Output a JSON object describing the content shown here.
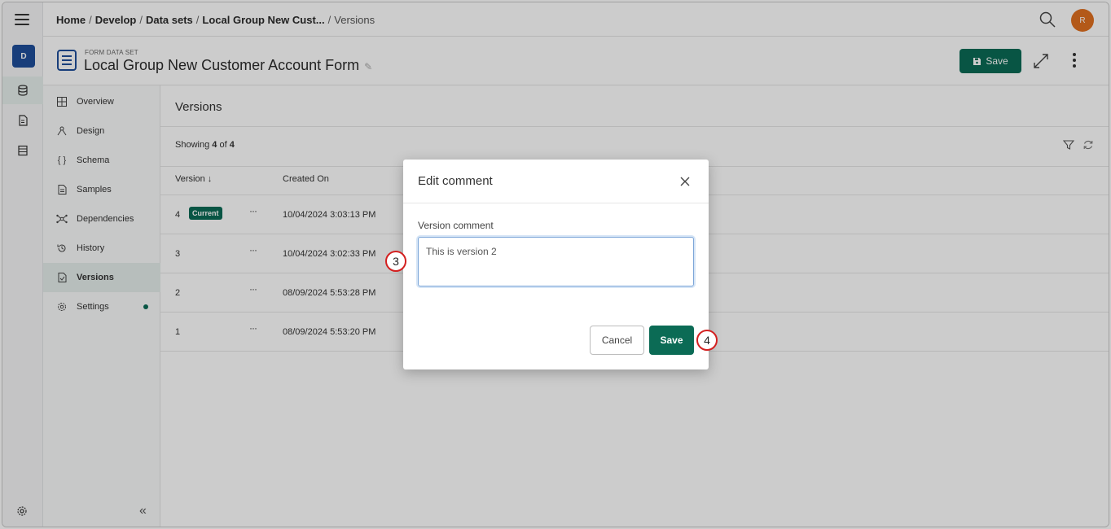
{
  "rail": {
    "space_initial": "D",
    "items": [
      {
        "icon": "database-icon",
        "active": true
      },
      {
        "icon": "document-icon",
        "active": false
      },
      {
        "icon": "table-icon",
        "active": false
      }
    ],
    "bottom_icon": "gear-icon"
  },
  "topbar": {
    "breadcrumb": [
      "Home",
      "Develop",
      "Data sets",
      "Local Group New Cust...",
      "Versions"
    ],
    "user_initial": "R"
  },
  "header": {
    "overline": "FORM DATA SET",
    "title": "Local Group New Customer Account Form",
    "save_label": "Save"
  },
  "sidenav": {
    "items": [
      {
        "label": "Overview",
        "icon": "grid-icon",
        "active": false
      },
      {
        "label": "Design",
        "icon": "design-icon",
        "active": false
      },
      {
        "label": "Schema",
        "icon": "braces-icon",
        "active": false
      },
      {
        "label": "Samples",
        "icon": "document-icon",
        "active": false
      },
      {
        "label": "Dependencies",
        "icon": "network-icon",
        "active": false
      },
      {
        "label": "History",
        "icon": "history-icon",
        "active": false
      },
      {
        "label": "Versions",
        "icon": "versions-icon",
        "active": true
      },
      {
        "label": "Settings",
        "icon": "gear-icon",
        "active": false,
        "dot": true
      }
    ]
  },
  "main": {
    "section_title": "Versions",
    "showing_prefix": "Showing",
    "showing_count": "4",
    "showing_of": "of",
    "showing_total": "4",
    "columns": [
      "Version ↓",
      "Created On"
    ],
    "rows": [
      {
        "version": "4",
        "badge": "Current",
        "created": "10/04/2024 3:03:13 PM"
      },
      {
        "version": "3",
        "badge": "",
        "created": "10/04/2024 3:02:33 PM"
      },
      {
        "version": "2",
        "badge": "",
        "created": "08/09/2024 5:53:28 PM"
      },
      {
        "version": "1",
        "badge": "",
        "created": "08/09/2024 5:53:20 PM"
      }
    ]
  },
  "modal": {
    "title": "Edit comment",
    "field_label": "Version comment",
    "field_value": "This is version 2",
    "cancel_label": "Cancel",
    "save_label": "Save"
  },
  "callouts": {
    "a": "3",
    "b": "4"
  },
  "colors": {
    "accent": "#0b6b55",
    "brand_blue": "#1f4e9a",
    "avatar": "#e07020",
    "callout_ring": "#d32020"
  }
}
